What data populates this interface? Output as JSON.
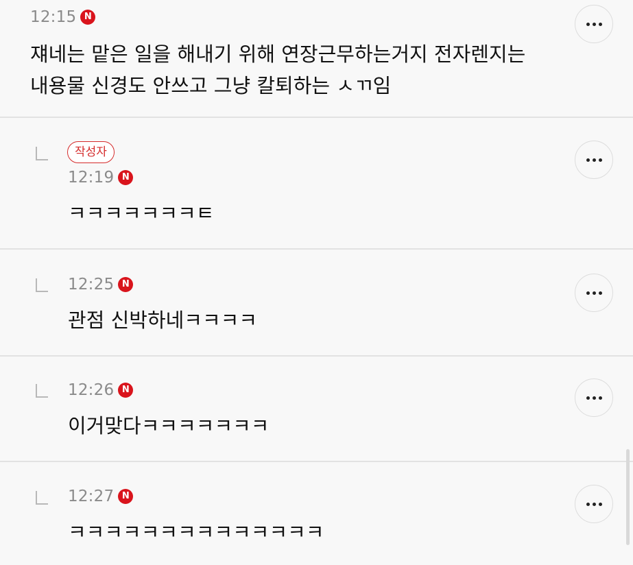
{
  "comments": [
    {
      "time": "12:15",
      "badge": "N",
      "text": "쟤네는 맡은 일을 해내기 위해 연장근무하는거지 전자렌지는\n내용물 신경도 안쓰고 그냥 칼퇴하는 ㅅㄲ임",
      "more_icon": "more-horizontal-icon"
    },
    {
      "author_label": "작성자",
      "time": "12:19",
      "badge": "N",
      "text": "ㅋㅋㅋㅋㅋㅋㅋㅌ",
      "more_icon": "more-horizontal-icon",
      "reply_icon": "reply-arrow-icon"
    },
    {
      "time": "12:25",
      "badge": "N",
      "text": "관점 신박하네ㅋㅋㅋㅋ",
      "more_icon": "more-horizontal-icon",
      "reply_icon": "reply-arrow-icon"
    },
    {
      "time": "12:26",
      "badge": "N",
      "text": "이거맞다ㅋㅋㅋㅋㅋㅋㅋ",
      "more_icon": "more-horizontal-icon",
      "reply_icon": "reply-arrow-icon"
    },
    {
      "time": "12:27",
      "badge": "N",
      "text": "ㅋㅋㅋㅋㅋㅋㅋㅋㅋㅋㅋㅋㅋㅋ",
      "more_icon": "more-horizontal-icon",
      "reply_icon": "reply-arrow-icon"
    }
  ],
  "colors": {
    "background": "#f8f8f8",
    "divider": "#e2e2e2",
    "time_text": "#8a8a8a",
    "new_badge": "#d9141c",
    "author_badge": "#d42a2a",
    "body_text": "#111111"
  }
}
